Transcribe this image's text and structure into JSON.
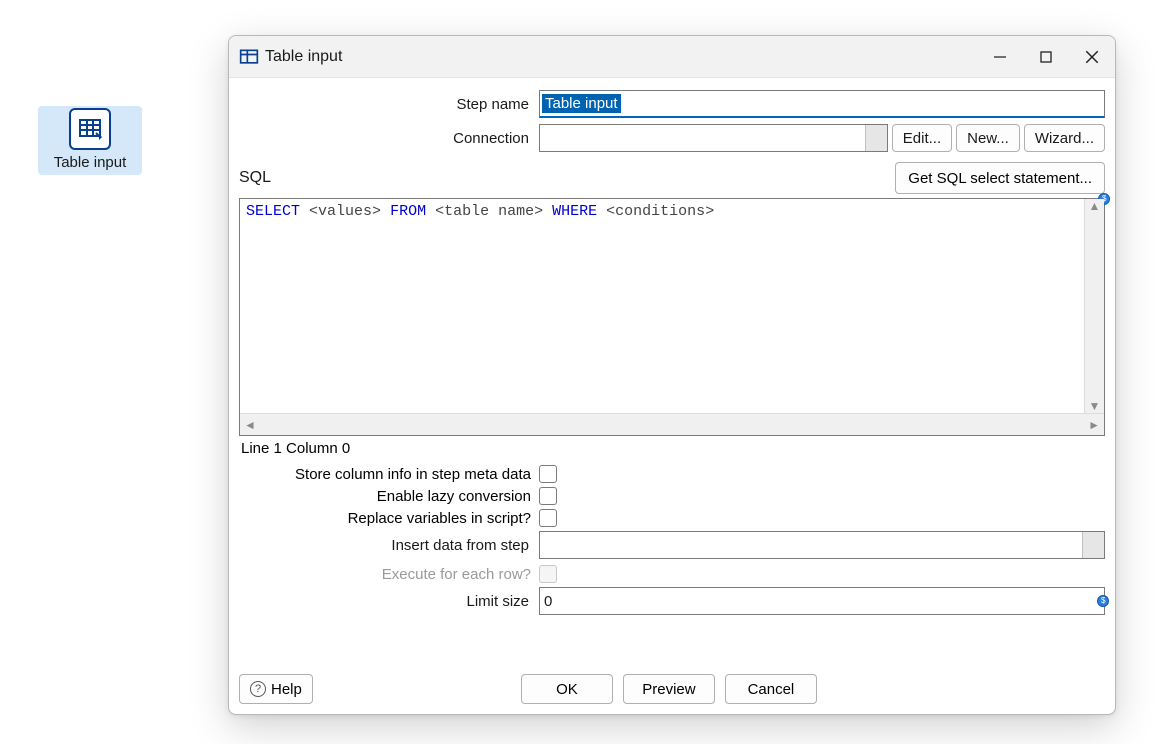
{
  "desktop": {
    "icon_caption": "Table input",
    "icon_name": "table-input-node-icon"
  },
  "window": {
    "title": "Table input",
    "controls": {
      "minimize": "minimize",
      "maximize": "maximize",
      "close": "close"
    }
  },
  "form": {
    "step_name_label": "Step name",
    "step_name_value": "Table input",
    "connection_label": "Connection",
    "connection_value": "",
    "connection_buttons": {
      "edit": "Edit...",
      "new": "New...",
      "wizard": "Wizard..."
    },
    "sql_label": "SQL",
    "get_sql_button": "Get SQL select statement...",
    "sql_tokens": [
      {
        "t": "SELECT",
        "c": "kw"
      },
      {
        "t": " ",
        "c": "sp"
      },
      {
        "t": "<values>",
        "c": "pl"
      },
      {
        "t": " ",
        "c": "sp"
      },
      {
        "t": "FROM",
        "c": "kw"
      },
      {
        "t": " ",
        "c": "sp"
      },
      {
        "t": "<table name>",
        "c": "pl"
      },
      {
        "t": " ",
        "c": "sp"
      },
      {
        "t": "WHERE",
        "c": "kw"
      },
      {
        "t": " ",
        "c": "sp"
      },
      {
        "t": "<conditions>",
        "c": "pl"
      }
    ],
    "status": "Line 1 Column 0",
    "store_col_label": "Store column info in step meta data",
    "store_col_checked": false,
    "lazy_label": "Enable lazy conversion",
    "lazy_checked": false,
    "replace_vars_label": "Replace variables in script?",
    "replace_vars_checked": false,
    "insert_from_label": "Insert data from step",
    "insert_from_value": "",
    "exec_each_label": "Execute for each row?",
    "exec_each_enabled": false,
    "exec_each_checked": false,
    "limit_label": "Limit size",
    "limit_value": "0"
  },
  "buttons": {
    "help": "Help",
    "ok": "OK",
    "preview": "Preview",
    "cancel": "Cancel"
  }
}
